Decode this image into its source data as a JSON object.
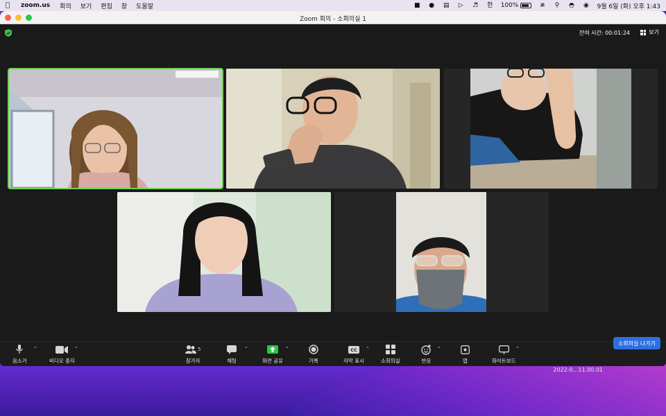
{
  "menubar": {
    "app_name": "zoom.us",
    "menus": [
      "회의",
      "보기",
      "편집",
      "창",
      "도움말"
    ],
    "battery_percent": "100%",
    "battery_level": "62",
    "clock": "9월 6일 (화) 오후  1:43"
  },
  "window": {
    "title": "Zoom 회의 - 소회의실 1"
  },
  "meeting": {
    "timer": "잔여 시간: 00:01:24",
    "view_label": "보기"
  },
  "toolbar": {
    "mute_label": "음소거",
    "video_label": "비디오 중지",
    "participants_label": "참가자",
    "participants_count": "5",
    "chat_label": "채팅",
    "share_label": "화면 공유",
    "record_label": "기록",
    "captions_label": "자막 표시",
    "breakout_label": "소회의실",
    "reactions_label": "반응",
    "apps_label": "앱",
    "whiteboard_label": "화이트보드",
    "leave_label": "소회의실 나가기"
  },
  "desktop": {
    "file_stamp": "2022-0...11.00.01"
  },
  "colors": {
    "active_speaker": "#6fd15b",
    "share_green": "#27c93f",
    "leave_blue": "#2d6fe3"
  }
}
